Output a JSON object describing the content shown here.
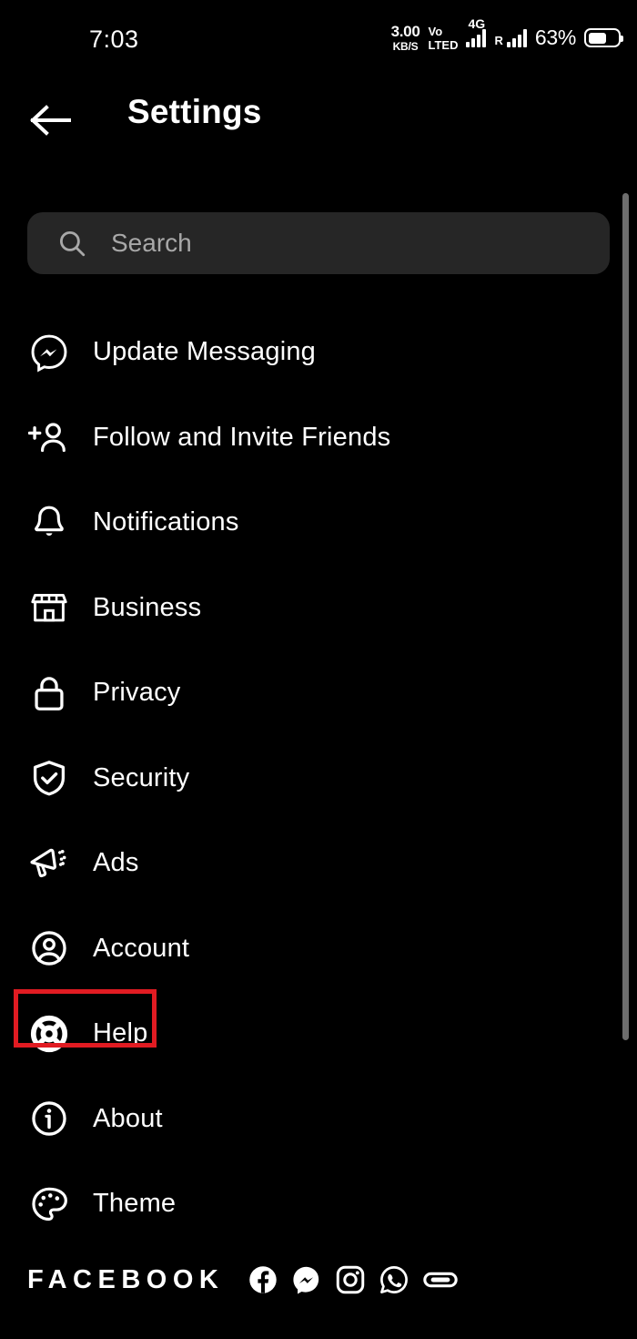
{
  "statusbar": {
    "time": "7:03",
    "net_speed_value": "3.00",
    "net_speed_unit": "KB/S",
    "volte_top": "Vo",
    "volte_bottom": "LTED",
    "network_type": "4G",
    "roaming": "R",
    "battery_percent": "63%",
    "signal_icon": "signal-bars-icon",
    "battery_icon": "battery-icon"
  },
  "header": {
    "back_icon": "back-arrow-icon",
    "title": "Settings"
  },
  "search": {
    "icon": "search-icon",
    "placeholder": "Search",
    "value": ""
  },
  "menu": {
    "items": [
      {
        "label": "Update Messaging",
        "icon": "messenger-icon"
      },
      {
        "label": "Follow and Invite Friends",
        "icon": "person-add-icon"
      },
      {
        "label": "Notifications",
        "icon": "bell-icon"
      },
      {
        "label": "Business",
        "icon": "store-icon"
      },
      {
        "label": "Privacy",
        "icon": "lock-icon"
      },
      {
        "label": "Security",
        "icon": "shield-check-icon"
      },
      {
        "label": "Ads",
        "icon": "megaphone-icon"
      },
      {
        "label": "Account",
        "icon": "account-circle-icon"
      },
      {
        "label": "Help",
        "icon": "lifebuoy-icon"
      },
      {
        "label": "About",
        "icon": "info-circle-icon"
      },
      {
        "label": "Theme",
        "icon": "palette-icon"
      }
    ]
  },
  "highlight": {
    "target_label": "Help",
    "color": "#e11b22"
  },
  "footer": {
    "brand": "FACEBOOK",
    "app_icons": [
      "facebook-icon",
      "messenger-icon",
      "instagram-icon",
      "whatsapp-icon",
      "oculus-icon"
    ]
  },
  "colors": {
    "background": "#000000",
    "search_field": "#262626",
    "placeholder_text": "#a8a8a8",
    "text": "#ffffff",
    "scrollbar": "#6e6e6e",
    "highlight": "#e11b22"
  },
  "scrollbar": {
    "name": "vertical-scrollbar"
  }
}
